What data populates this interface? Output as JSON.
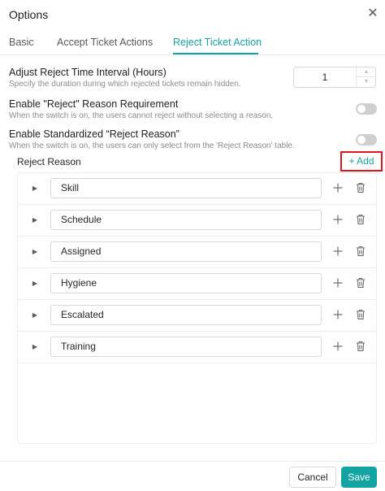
{
  "dialog": {
    "title": "Options",
    "close_icon": "close-icon"
  },
  "tabs": [
    {
      "label": "Basic",
      "active": false
    },
    {
      "label": "Accept Ticket Actions",
      "active": false
    },
    {
      "label": "Reject Ticket Action",
      "active": true
    }
  ],
  "settings": {
    "interval": {
      "title": "Adjust Reject Time Interval (Hours)",
      "description": "Specify the duration during which rejected tickets remain hidden.",
      "value": "1"
    },
    "reason_requirement": {
      "title": "Enable \"Reject\" Reason Requirement",
      "description": "When the switch is on, the users cannot reject without selecting a reason.",
      "enabled": false
    },
    "standardized_reason": {
      "title": "Enable Standardized “Reject Reason”",
      "description": "When the switch is on, the users can only select from the 'Reject Reason' table.",
      "enabled": false
    }
  },
  "reject_reason": {
    "label": "Reject Reason",
    "add_label": "+ Add",
    "items": [
      "Skill",
      "Schedule",
      "Assigned",
      "Hygiene",
      "Escalated",
      "Training"
    ]
  },
  "footer": {
    "cancel_label": "Cancel",
    "save_label": "Save"
  },
  "colors": {
    "accent": "#14a3a3",
    "highlight": "#e0161d",
    "switch_off": "#cfcfcf"
  }
}
